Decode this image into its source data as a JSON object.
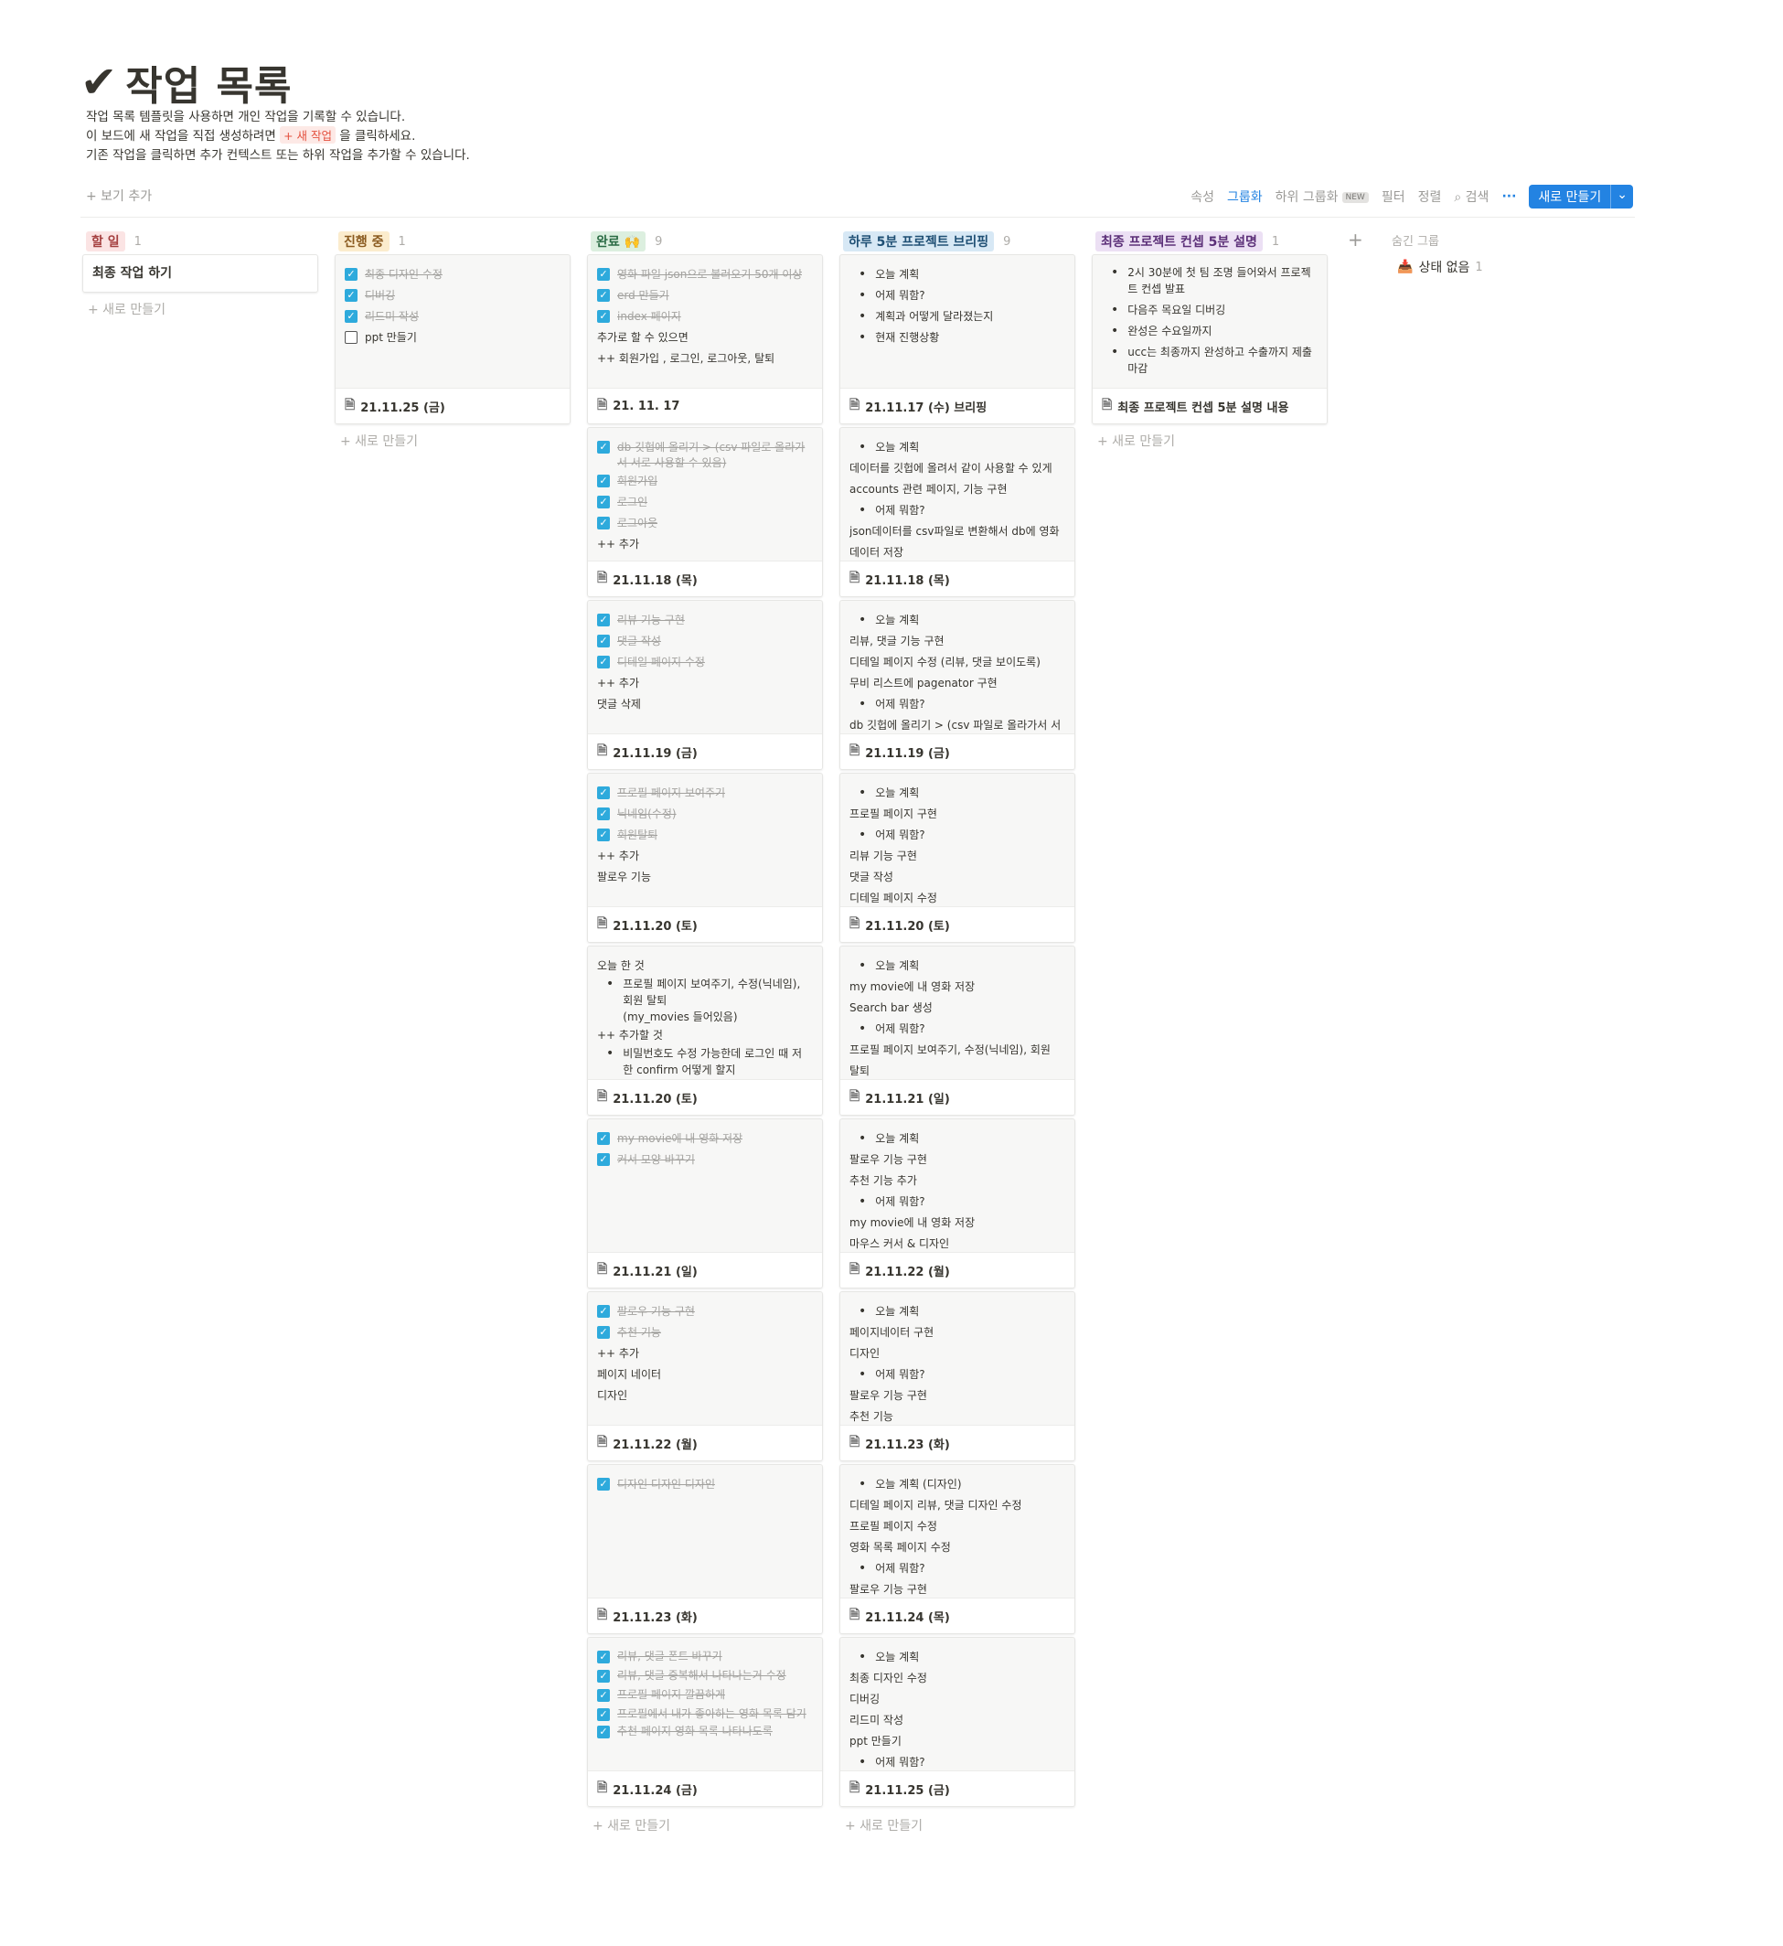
{
  "page": {
    "title_icon": "checkmark-icon",
    "title": "작업 목록",
    "desc1": "작업 목록 템플릿을 사용하면 개인 작업을 기록할 수 있습니다.",
    "desc2_a": "이 보드에 새 작업을 직접 생성하려면",
    "desc2_tag": "+ 새 작업",
    "desc2_b": "을 클릭하세요.",
    "desc3": "기존 작업을 클릭하면 추가 컨텍스트 또는 하위 작업을 추가할 수 있습니다."
  },
  "toolbar": {
    "add_view": "+ 보기 추가",
    "properties": "속성",
    "group": "그룹화",
    "subgroup": "하위 그룹화",
    "new_badge": "NEW",
    "filter": "필터",
    "sort": "정렬",
    "search": "검색",
    "more": "···",
    "new_button": "새로 만들기",
    "new_arrow": "⌄"
  },
  "columns": {
    "todo": {
      "label": "할 일",
      "count": "1",
      "color": "#fbe4e4",
      "text": "#a43f3f"
    },
    "progress": {
      "label": "진행 중",
      "count": "1",
      "color": "#fbeccd",
      "text": "#8a5a1f"
    },
    "done": {
      "label": "완료 🙌",
      "count": "9",
      "color": "#dcefdf",
      "text": "#2a6b44"
    },
    "brief": {
      "label": "하루 5분 프로젝트 브리핑",
      "count": "9",
      "color": "#d7e8f5",
      "text": "#1f4f74"
    },
    "final": {
      "label": "최종 프로젝트 컨셉 5분 설명",
      "count": "1",
      "color": "#ece0f4",
      "text": "#5b2f78"
    },
    "add_group": "+",
    "hidden_groups": "숨긴 그룹",
    "no_status": "상태 없음",
    "no_status_count": "1"
  },
  "new_item": "+ 새로 만들기",
  "todo_card": "최종 작업 하기",
  "progress_card": {
    "items": [
      "최종 디자인 수정",
      "디버깅",
      "리드미 작성",
      "ppt 만들기"
    ],
    "date": "21.11.25 (금)"
  },
  "done_cards": [
    {
      "checks": [
        "영화 파일 json으로 불러오기 50개 이상",
        "erd 만들기",
        "index 페이지"
      ],
      "texts": [
        "추가로 할 수 있으면",
        "++ 회원가입 , 로그인, 로그아웃, 탈퇴"
      ],
      "date": "21. 11. 17"
    },
    {
      "checks": [
        "db 깃헙에 올리기 > (csv 파일로 올라가서 서로 사용할 수 있음)",
        "회원가입",
        "로그인",
        "로그아웃"
      ],
      "texts": [
        "++ 추가"
      ],
      "date": "21.11.18 (목)"
    },
    {
      "checks": [
        "리뷰 기능 구현",
        "댓글 작성",
        "디테일 페이지 수정"
      ],
      "texts": [
        "++ 추가",
        "댓글 삭제"
      ],
      "date": "21.11.19 (금)"
    },
    {
      "checks": [
        "프로필 페이지 보여주기",
        "닉네임(수정)",
        "회원탈퇴"
      ],
      "texts": [
        "++ 추가",
        "팔로우 기능"
      ],
      "date": "21.11.20 (토)"
    },
    {
      "today": "오늘 한 것",
      "bul1": "프로필 페이지 보여주기, 수정(닉네임),",
      "bul1b": "회원 탈퇴",
      "bul1c": "(my_movies 들어있음)",
      "todo": "++ 추가할 것",
      "bul2": "비밀번호도 수정 가능한데 로그인 때 저",
      "bul2b": "한 confirm 어떻게 할지",
      "date": "21.11.20 (토)"
    },
    {
      "checks": [
        "my movie에 내 영화 저장",
        "커서 모양 바꾸기"
      ],
      "texts": [],
      "date": "21.11.21 (일)"
    },
    {
      "checks": [
        "팔로우 기능 구현",
        "추천 기능"
      ],
      "texts": [
        "++ 추가",
        "페이지 네이터",
        "디자인"
      ],
      "date": "21.11.22 (월)"
    },
    {
      "checks": [
        "디자인 디자인 디자인"
      ],
      "texts": [],
      "date": "21.11.23 (화)"
    },
    {
      "checks": [
        "리뷰, 댓글 폰트 바꾸기",
        "리뷰, 댓글 중복해서 나타나는거 수정",
        "프로필 페이지 깔끔하게",
        "프로필에서 내가 좋아하는 영화 목록 담기",
        "추천 페이지 영화 목록 나타나도록"
      ],
      "texts": [],
      "date": "21.11.24 (금)"
    }
  ],
  "brief_cards": [
    {
      "lines": [
        [
          "b",
          "오늘 계획"
        ],
        [
          "b",
          "어제 뭐함?"
        ],
        [
          "b",
          "계획과 어떻게 달라졌는지"
        ],
        [
          "b",
          "현재 진행상황"
        ]
      ],
      "date": "21.11.17 (수) 브리핑"
    },
    {
      "lines": [
        [
          "b",
          "오늘 계획"
        ],
        [
          "t",
          "데이터를 깃헙에 올려서 같이 사용할 수 있게"
        ],
        [
          "t",
          "accounts 관련 페이지, 기능 구현"
        ],
        [
          "b",
          "어제 뭐함?"
        ],
        [
          "t",
          "json데이터를 csv파일로 변환해서 db에 영화"
        ],
        [
          "t",
          "데이터 저장"
        ]
      ],
      "date": "21.11.18 (목)"
    },
    {
      "lines": [
        [
          "b",
          "오늘 계획"
        ],
        [
          "t",
          "리뷰, 댓글 기능 구현"
        ],
        [
          "t",
          "디테일 페이지 수정 (리뷰, 댓글 보이도록)"
        ],
        [
          "t",
          "무비 리스트에 pagenator 구현"
        ],
        [
          "b",
          "어제 뭐함?"
        ],
        [
          "t",
          "db 깃헙에 올리기 > (csv 파일로 올라가서 서"
        ]
      ],
      "date": "21.11.19 (금)"
    },
    {
      "lines": [
        [
          "b",
          "오늘 계획"
        ],
        [
          "t",
          "프로필 페이지 구현"
        ],
        [
          "b",
          "어제 뭐함?"
        ],
        [
          "t",
          "리뷰 기능 구현"
        ],
        [
          "t",
          "댓글 작성"
        ],
        [
          "t",
          "디테일 페이지 수정"
        ]
      ],
      "date": "21.11.20 (토)"
    },
    {
      "lines": [
        [
          "b",
          "오늘 계획"
        ],
        [
          "t",
          "my movie에 내 영화 저장"
        ],
        [
          "t",
          "Search bar 생성"
        ],
        [
          "b",
          "어제 뭐함?"
        ],
        [
          "t",
          "프로필 페이지 보여주기, 수정(닉네임), 회원"
        ],
        [
          "t",
          "탈퇴"
        ]
      ],
      "date": "21.11.21 (일)"
    },
    {
      "lines": [
        [
          "b",
          "오늘 계획"
        ],
        [
          "t",
          "팔로우 기능 구현"
        ],
        [
          "t",
          "추천 기능 추가"
        ],
        [
          "b",
          "어제 뭐함?"
        ],
        [
          "t",
          "my movie에 내 영화 저장"
        ],
        [
          "t",
          "마우스 커서 & 디자인"
        ]
      ],
      "date": "21.11.22 (월)"
    },
    {
      "lines": [
        [
          "b",
          "오늘 계획"
        ],
        [
          "t",
          "페이지네이터 구현"
        ],
        [
          "t",
          "디자인"
        ],
        [
          "b",
          "어제 뭐함?"
        ],
        [
          "t",
          "팔로우 기능 구현"
        ],
        [
          "t",
          "추천 기능"
        ]
      ],
      "date": "21.11.23 (화)"
    },
    {
      "lines": [
        [
          "b",
          "오늘 계획 (디자인)"
        ],
        [
          "t",
          "디테일 페이지 리뷰, 댓글 디자인 수정"
        ],
        [
          "t",
          "프로필 페이지 수정"
        ],
        [
          "t",
          "영화 목록 페이지 수정"
        ],
        [
          "b",
          "어제 뭐함?"
        ],
        [
          "t",
          "팔로우 기능 구현"
        ]
      ],
      "date": "21.11.24 (목)"
    },
    {
      "lines": [
        [
          "b",
          "오늘 계획"
        ],
        [
          "t",
          "최종 디자인 수정"
        ],
        [
          "t",
          "디버깅"
        ],
        [
          "t",
          "리드미 작성"
        ],
        [
          "t",
          "ppt 만들기"
        ],
        [
          "b",
          "어제 뭐함?"
        ]
      ],
      "date": "21.11.25 (금)"
    }
  ],
  "final_card": {
    "lines": [
      "2시 30분에 첫 팀 조명 들어와서 프로젝",
      "트 컨셉 발표",
      "다음주 목요일 디버깅",
      "완성은 수요일까지",
      "ucc는 최종까지 완성하고 수출까지 제출",
      "마감"
    ],
    "title": "최종 프로젝트 컨셉 5분 설명 내용"
  }
}
